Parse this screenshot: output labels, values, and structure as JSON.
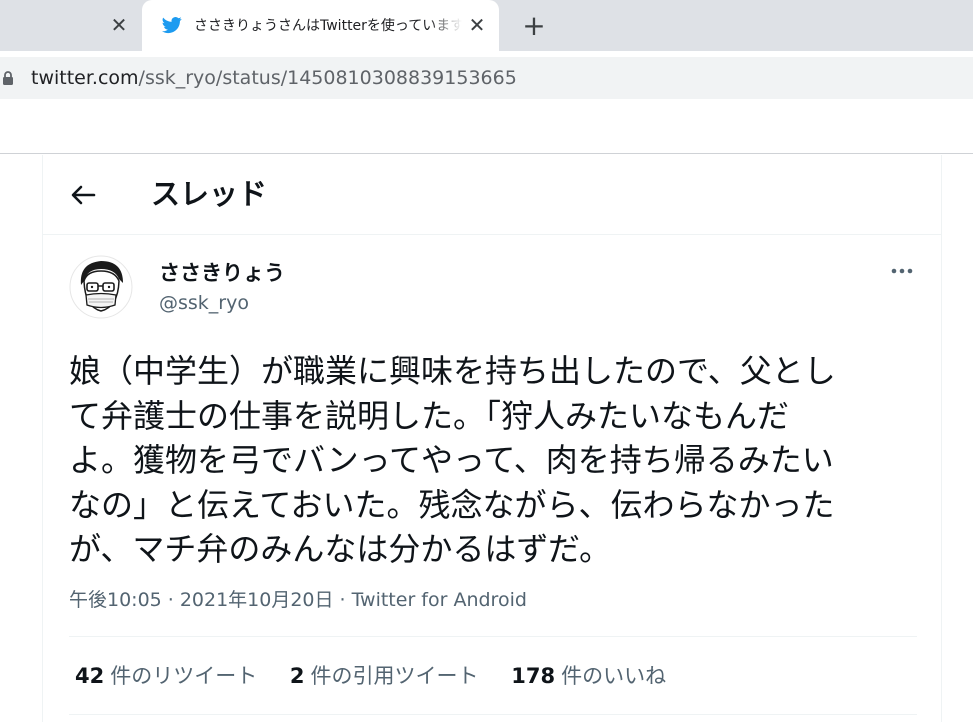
{
  "browser": {
    "prev_tab_close": "✕",
    "active_tab": {
      "icon": "twitter-bird-icon",
      "title": "ささきりょうさんはTwitterを使っています",
      "close": "✕"
    },
    "new_tab": "+",
    "url_host": "twitter.com",
    "url_path": "/ssk_ryo/status/1450810308839153665"
  },
  "header": {
    "back_icon": "arrow-left-icon",
    "title": "スレッド"
  },
  "tweet": {
    "display_name": "ささきりょう",
    "handle": "@ssk_ryo",
    "text": "娘（中学生）が職業に興味を持ち出したので、父とし\nて弁護士の仕事を説明した。「狩人みたいなもんだ\nよ。獲物を弓でバンってやって、肉を持ち帰るみたい\nなの」と伝えておいた。残念ながら、伝わらなかった\nが、マチ弁のみんなは分かるはずだ。",
    "time": "午後10:05",
    "date": "2021年10月20日",
    "source": "Twitter for Android",
    "meta_separator": "·"
  },
  "stats": {
    "retweets_count": "42",
    "retweets_label": "件のリツイート",
    "quotes_count": "2",
    "quotes_label": "件の引用ツイート",
    "likes_count": "178",
    "likes_label": "件のいいね"
  },
  "colors": {
    "twitter_blue": "#1d9bf0",
    "text_primary": "#0f1419",
    "text_secondary": "#536471",
    "tabstrip_bg": "#dee1e6"
  }
}
